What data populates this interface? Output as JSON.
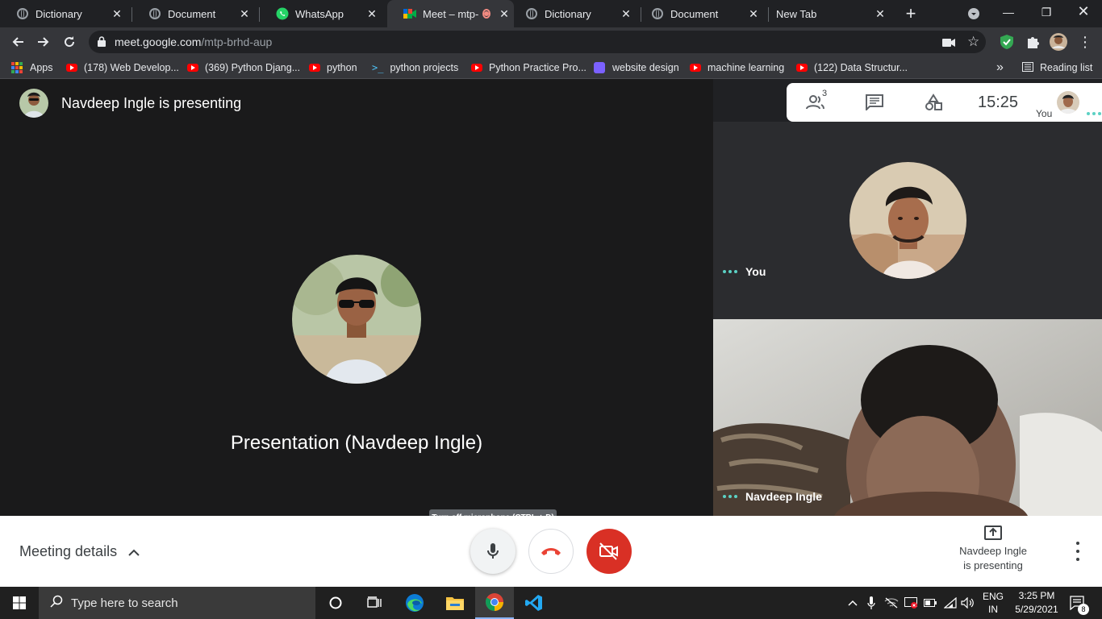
{
  "tabs": [
    {
      "title": "Dictionary",
      "icon": "globe-icon"
    },
    {
      "title": "Document",
      "icon": "globe-icon"
    },
    {
      "title": "WhatsApp",
      "icon": "whatsapp-icon"
    },
    {
      "title": "Meet – mtp-l",
      "icon": "meet-icon",
      "active": true,
      "recording": true
    },
    {
      "title": "Dictionary",
      "icon": "globe-icon"
    },
    {
      "title": "Document",
      "icon": "globe-icon"
    },
    {
      "title": "New Tab",
      "icon": "none"
    }
  ],
  "address": {
    "host": "meet.google.com",
    "path": "/mtp-brhd-aup"
  },
  "bookmarks": {
    "apps_label": "Apps",
    "items": [
      {
        "label": "(178) Web Develop...",
        "icon": "youtube-icon"
      },
      {
        "label": "(369) Python Djang...",
        "icon": "youtube-icon"
      },
      {
        "label": "python",
        "icon": "youtube-icon"
      },
      {
        "label": "python projects",
        "icon": "terminal-icon"
      },
      {
        "label": "Python Practice Pro...",
        "icon": "youtube-icon"
      },
      {
        "label": "website design",
        "icon": "purple-app-icon"
      },
      {
        "label": "machine learning",
        "icon": "youtube-icon"
      },
      {
        "label": "(122) Data Structur...",
        "icon": "youtube-icon"
      }
    ],
    "overflow": "»",
    "reading_list": "Reading list"
  },
  "meet": {
    "presenter_header": "Navdeep Ingle is presenting",
    "presentation_label": "Presentation (Navdeep Ingle)",
    "participants_count": "3",
    "clock": "15:25",
    "you_label": "You",
    "tile_you_name": "You",
    "tile_other_name": "Navdeep Ingle",
    "tooltip": "Turn off microphone (CTRL + D)",
    "meeting_details": "Meeting details",
    "present_status_line1": "Navdeep Ingle",
    "present_status_line2": "is presenting",
    "end_call_color": "#ea4335",
    "cam_off_color": "#d93025"
  },
  "taskbar": {
    "search_placeholder": "Type here to search",
    "lang_line1": "ENG",
    "lang_line2": "IN",
    "time": "3:25 PM",
    "date": "5/29/2021",
    "notifications": "8"
  }
}
